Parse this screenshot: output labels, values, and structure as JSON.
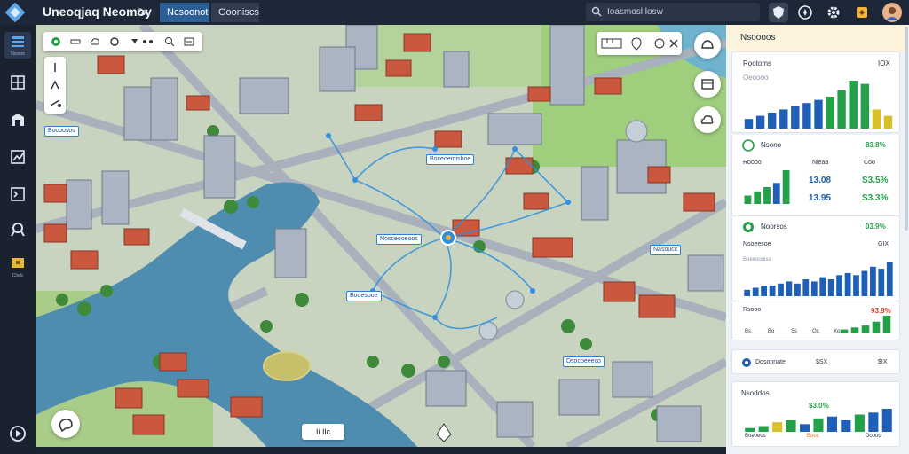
{
  "app": {
    "title": "Uneoqjaq Neomoy",
    "tabs": [
      "Sx",
      "Ncsoonot",
      "Gooniscs"
    ],
    "search_placeholder": "Ioasmosl losw"
  },
  "sidebar": {
    "items": [
      {
        "icon": "layers-icon",
        "label": "Ncoors"
      },
      {
        "icon": "grid-icon",
        "label": ""
      },
      {
        "icon": "building-icon",
        "label": ""
      },
      {
        "icon": "chart-icon",
        "label": ""
      },
      {
        "icon": "terminal-icon",
        "label": ""
      },
      {
        "icon": "pin-icon",
        "label": ""
      },
      {
        "icon": "folder-icon",
        "label": "Clsdc"
      },
      {
        "icon": "play-icon",
        "label": ""
      }
    ]
  },
  "map": {
    "labels": [
      "Boceoemisboe",
      "Nosceooeoos",
      "Booesooe",
      "Bocoosos",
      "Nasoucc",
      "Dsocoeeeco"
    ],
    "bottom_chip": "Ii Ilc"
  },
  "panel": {
    "header": "Nsoooos",
    "cards": [
      {
        "title": "Rootoms",
        "value": "IOX",
        "sublabel": "Oeoooo",
        "chart": {
          "values": [
            3,
            4,
            5,
            6,
            7,
            8,
            9,
            10,
            12,
            15,
            14,
            6,
            4
          ],
          "colors": [
            "#1f5fb8",
            "#1f5fb8",
            "#1f5fb8",
            "#1f5fb8",
            "#1f5fb8",
            "#1f5fb8",
            "#1f5fb8",
            "#24a148",
            "#24a148",
            "#24a148",
            "#24a148",
            "#d8c028",
            "#d8c028"
          ]
        }
      },
      {
        "title": "Nsono",
        "value": "83.8%",
        "row_labels": [
          "Roooo",
          "Nieaa",
          "Coo"
        ],
        "stats": [
          "13.08",
          "13.95",
          "S3.5%",
          "S3.3%"
        ],
        "chart": {
          "values": [
            2,
            3,
            4,
            5,
            8
          ],
          "colors": [
            "#24a148",
            "#24a148",
            "#24a148",
            "#1f5fb8",
            "#24a148"
          ]
        }
      },
      {
        "title": "Noorsos",
        "value": "03.9%",
        "sublabel": "Nsoeesoe",
        "sublabel_value": "GIX",
        "bar_caption": "Boeeoooiss",
        "chart": {
          "values": [
            3,
            4,
            5,
            5,
            6,
            7,
            6,
            8,
            7,
            9,
            8,
            10,
            11,
            10,
            12,
            14,
            13,
            16
          ],
          "colors": [
            "#1f5fb8"
          ]
        }
      },
      {
        "title": "Rsooo",
        "value": "93.9%",
        "legend": [
          "Bs",
          "Bo",
          "Ss",
          "Os",
          "Xo"
        ],
        "chart": {
          "values": [
            2,
            3,
            4,
            6,
            9
          ],
          "colors": [
            "#24a148"
          ]
        }
      },
      {
        "title": "Dosonnate",
        "value": "$SX",
        "value2": "$IX"
      },
      {
        "title": "Nsoddos",
        "value": "$3.0%",
        "footer": [
          "Boeoeos",
          "Boos",
          "Doooo"
        ],
        "chart": {
          "values": [
            2,
            3,
            5,
            6,
            4,
            7,
            8,
            6,
            9,
            10,
            12
          ],
          "colors": [
            "#24a148",
            "#24a148",
            "#d8c028",
            "#24a148",
            "#1f5fb8",
            "#24a148",
            "#1f5fb8",
            "#1f5fb8",
            "#24a148",
            "#1f5fb8",
            "#1f5fb8"
          ]
        }
      }
    ]
  },
  "colors": {
    "accent": "#2b5f96",
    "positive": "#24a148",
    "negative": "#d93a2b",
    "river": "#4f8db0",
    "road": "#9ca7b3"
  }
}
